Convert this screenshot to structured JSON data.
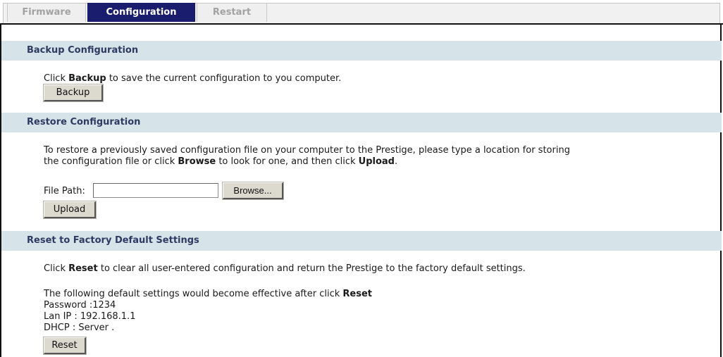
{
  "tabs": [
    {
      "label": "Firmware",
      "active": false
    },
    {
      "label": "Configuration",
      "active": true
    },
    {
      "label": "Restart",
      "active": false
    }
  ],
  "backup": {
    "title": "Backup Configuration",
    "desc_prefix": "Click ",
    "desc_bold": "Backup",
    "desc_suffix": " to save the current configuration to you computer.",
    "button": "Backup"
  },
  "restore": {
    "title": "Restore Configuration",
    "line1": "To restore a previously saved configuration file on your computer to the Prestige, please type a location for storing",
    "line2_prefix": "the configuration file or click ",
    "line2_bold1": "Browse",
    "line2_mid": " to look for one, and then click ",
    "line2_bold2": "Upload",
    "line2_suffix": ".",
    "file_path_label": "File Path:",
    "file_path_value": "",
    "browse_button": "Browse...",
    "upload_button": "Upload"
  },
  "reset": {
    "title": "Reset to Factory Default Settings",
    "desc_prefix": "Click ",
    "desc_bold": "Reset",
    "desc_suffix": " to clear all user-entered configuration and return the Prestige to the factory default settings.",
    "defaults_prefix": "The following default settings would become effective after click ",
    "defaults_bold": "Reset",
    "password": "Password :1234",
    "lan_ip": "Lan IP : 192.168.1.1",
    "dhcp": "DHCP : Server .",
    "button": "Reset"
  }
}
